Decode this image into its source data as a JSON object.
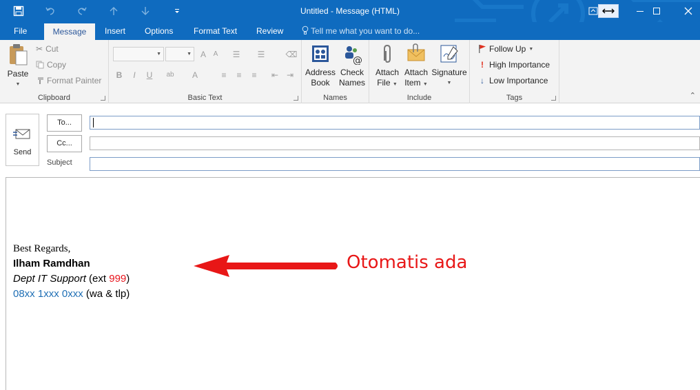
{
  "window": {
    "title": "Untitled - Message (HTML)",
    "minimize_icon": "minimize-icon",
    "restore_icon": "restore-icon",
    "close_icon": "close-icon"
  },
  "tabs": [
    {
      "label": "File"
    },
    {
      "label": "Message"
    },
    {
      "label": "Insert"
    },
    {
      "label": "Options"
    },
    {
      "label": "Format Text"
    },
    {
      "label": "Review"
    }
  ],
  "tell_me": "Tell me what you want to do...",
  "ribbon": {
    "clipboard": {
      "label": "Clipboard",
      "paste": "Paste",
      "cut": "Cut",
      "copy": "Copy",
      "format_painter": "Format Painter"
    },
    "basic_text": {
      "label": "Basic Text"
    },
    "names": {
      "label": "Names",
      "address_book_1": "Address",
      "address_book_2": "Book",
      "check_names_1": "Check",
      "check_names_2": "Names"
    },
    "include": {
      "label": "Include",
      "attach_file_1": "Attach",
      "attach_file_2": "File",
      "attach_item_1": "Attach",
      "attach_item_2": "Item",
      "signature": "Signature"
    },
    "tags": {
      "label": "Tags",
      "follow_up": "Follow Up",
      "high_importance": "High Importance",
      "low_importance": "Low Importance"
    }
  },
  "compose": {
    "send": "Send",
    "to": "To...",
    "cc": "Cc...",
    "subject": "Subject",
    "to_value": "",
    "cc_value": "",
    "subject_value": ""
  },
  "signature": {
    "line1": "Best Regards,",
    "line2": "Ilham Ramdhan",
    "line3_text": "Dept IT Support",
    "line3_pre": " (ext ",
    "line3_ext": "999",
    "line3_post": ")",
    "line4_phone": "08xx 1xxx 0xxx",
    "line4_note": " (wa & tlp)"
  },
  "annotation": {
    "text": "Otomatis ada"
  },
  "colors": {
    "brand": "#0f6bbf",
    "annotation": "#e81717",
    "phone": "#1f6fb5"
  }
}
